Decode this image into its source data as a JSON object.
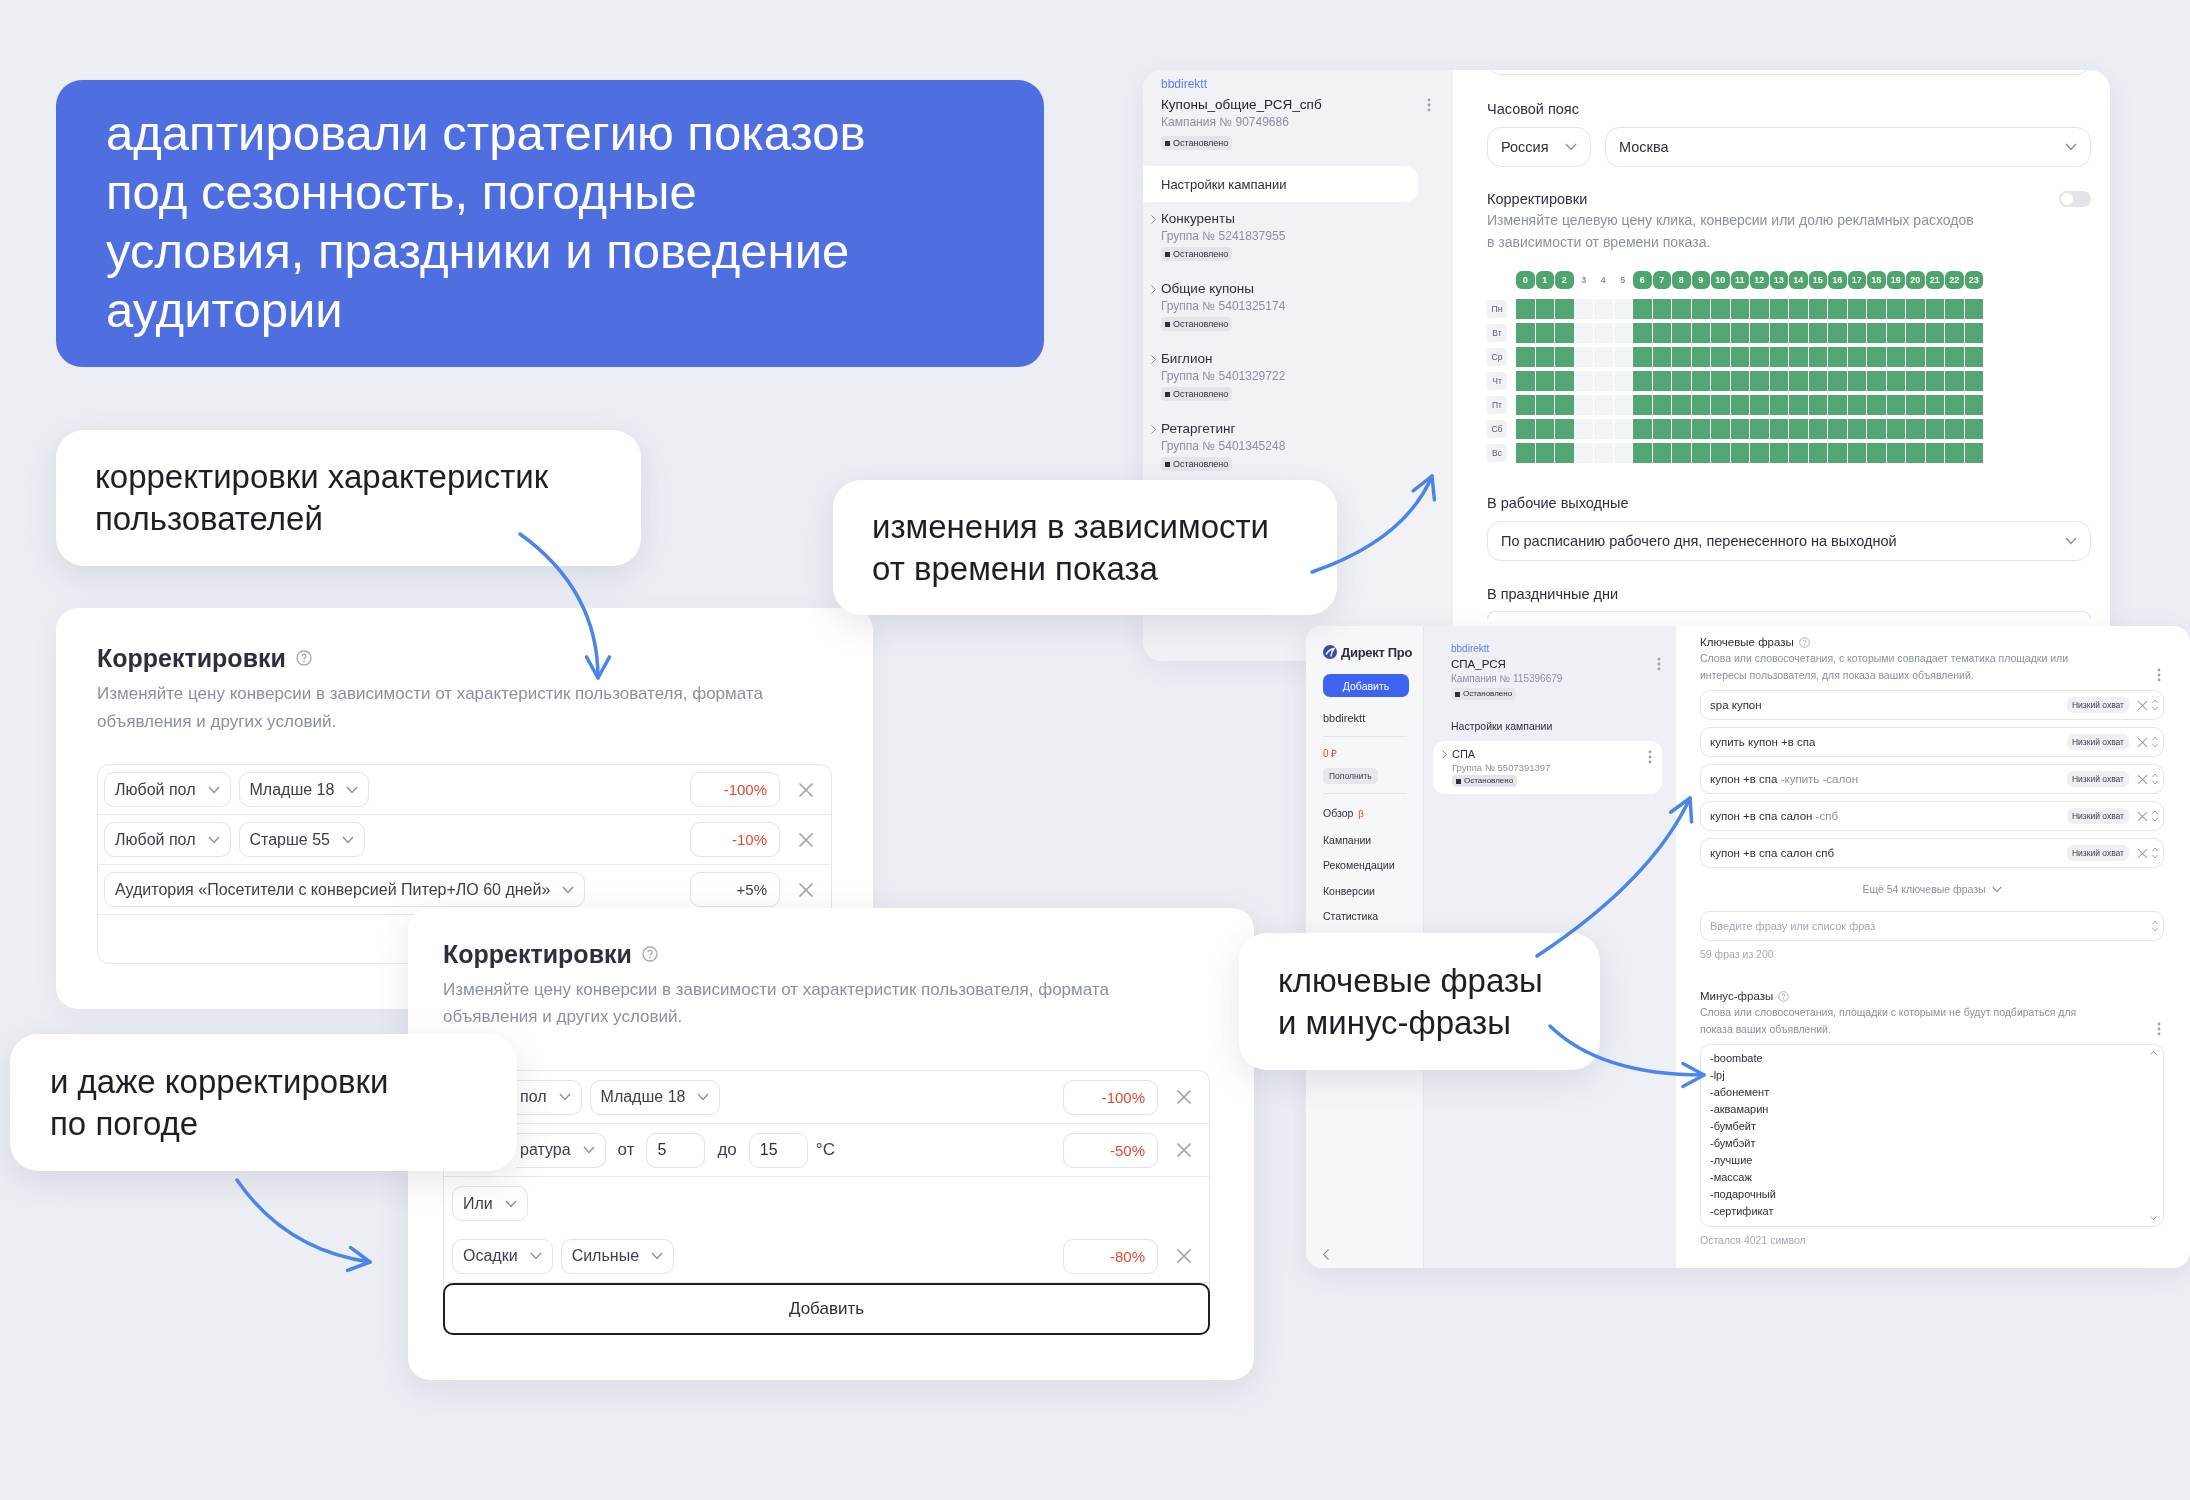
{
  "headline": {
    "lines": [
      "адаптировали стратегию показов",
      "под сезонность, погодные",
      "условия, праздники и поведение",
      "аудитории"
    ]
  },
  "campaign_window": {
    "account": "bbdirektt",
    "campaign": "Купоны_общие_РСЯ_спб",
    "campaign_number": "Кампания № 90749686",
    "status": "Остановлено",
    "sidebar_items": [
      {
        "kind": "settings",
        "label": "Настройки кампании",
        "selected": true
      },
      {
        "kind": "group",
        "name": "Конкуренты",
        "number": "Группа № 5241837955",
        "status": "Остановлено",
        "selected": false
      },
      {
        "kind": "group",
        "name": "Общие купоны",
        "number": "Группа № 5401325174",
        "status": "Остановлено",
        "selected": false
      },
      {
        "kind": "group",
        "name": "Биглион",
        "number": "Группа № 5401329722",
        "status": "Остановлено",
        "selected": false
      },
      {
        "kind": "group",
        "name": "Ретаргетинг",
        "number": "Группа № 5401345248",
        "status": "Остановлено",
        "selected": false
      }
    ],
    "timezone": {
      "label": "Часовой пояс",
      "country": "Россия",
      "city": "Москва"
    },
    "adjustments": {
      "label": "Корректировки",
      "on": false,
      "description_lines": [
        "Изменяйте целевую цену клика, конверсии или долю рекламных расходов",
        "в зависимости от времени показа."
      ]
    },
    "schedule": {
      "hours": [
        {
          "label": "0",
          "on": true
        },
        {
          "label": "1",
          "on": true
        },
        {
          "label": "2",
          "on": true
        },
        {
          "label": "3",
          "on": false
        },
        {
          "label": "4",
          "on": false
        },
        {
          "label": "5",
          "on": false
        },
        {
          "label": "6",
          "on": true
        },
        {
          "label": "7",
          "on": true
        },
        {
          "label": "8",
          "on": true
        },
        {
          "label": "9",
          "on": true
        },
        {
          "label": "10",
          "on": true
        },
        {
          "label": "11",
          "on": true
        },
        {
          "label": "12",
          "on": true
        },
        {
          "label": "13",
          "on": true
        },
        {
          "label": "14",
          "on": true
        },
        {
          "label": "15",
          "on": true
        },
        {
          "label": "16",
          "on": true
        },
        {
          "label": "17",
          "on": true
        },
        {
          "label": "18",
          "on": true
        },
        {
          "label": "19",
          "on": true
        },
        {
          "label": "20",
          "on": true
        },
        {
          "label": "21",
          "on": true
        },
        {
          "label": "22",
          "on": true
        },
        {
          "label": "23",
          "on": true
        }
      ],
      "days": [
        {
          "label": "Пн",
          "cells": [
            true,
            true,
            true,
            false,
            false,
            false,
            true,
            true,
            true,
            true,
            true,
            true,
            true,
            true,
            true,
            true,
            true,
            true,
            true,
            true,
            true,
            true,
            true,
            true
          ]
        },
        {
          "label": "Вт",
          "cells": [
            true,
            true,
            true,
            false,
            false,
            false,
            true,
            true,
            true,
            true,
            true,
            true,
            true,
            true,
            true,
            true,
            true,
            true,
            true,
            true,
            true,
            true,
            true,
            true
          ]
        },
        {
          "label": "Ср",
          "cells": [
            true,
            true,
            true,
            false,
            false,
            false,
            true,
            true,
            true,
            true,
            true,
            true,
            true,
            true,
            true,
            true,
            true,
            true,
            true,
            true,
            true,
            true,
            true,
            true
          ]
        },
        {
          "label": "Чт",
          "cells": [
            true,
            true,
            true,
            false,
            false,
            false,
            true,
            true,
            true,
            true,
            true,
            true,
            true,
            true,
            true,
            true,
            true,
            true,
            true,
            true,
            true,
            true,
            true,
            true
          ]
        },
        {
          "label": "Пт",
          "cells": [
            true,
            true,
            true,
            false,
            false,
            false,
            true,
            true,
            true,
            true,
            true,
            true,
            true,
            true,
            true,
            true,
            true,
            true,
            true,
            true,
            true,
            true,
            true,
            true
          ]
        },
        {
          "label": "Сб",
          "cells": [
            true,
            true,
            true,
            false,
            false,
            false,
            true,
            true,
            true,
            true,
            true,
            true,
            true,
            true,
            true,
            true,
            true,
            true,
            true,
            true,
            true,
            true,
            true,
            true
          ]
        },
        {
          "label": "Вс",
          "cells": [
            true,
            true,
            true,
            false,
            false,
            false,
            true,
            true,
            true,
            true,
            true,
            true,
            true,
            true,
            true,
            true,
            true,
            true,
            true,
            true,
            true,
            true,
            true,
            true
          ]
        }
      ]
    },
    "working_weekends": {
      "label": "В рабочие выходные",
      "value": "По расписанию рабочего дня, перенесенного на выходной"
    },
    "holidays": {
      "label": "В праздничные дни"
    }
  },
  "direct_window": {
    "brand": "Директ Про",
    "add_button": "Добавить",
    "account": "bbdirektt",
    "balance": "0 ₽",
    "topup_button": "Пополнить",
    "nav": [
      {
        "label": "Обзор",
        "badge": "β"
      },
      {
        "label": "Кампании"
      },
      {
        "label": "Рекомендации"
      },
      {
        "label": "Конверсии"
      },
      {
        "label": "Статистика"
      }
    ],
    "campaign": {
      "account": "bbdirektt",
      "name": "СПА_РСЯ",
      "number": "Кампания № 115396679",
      "status": "Остановлено"
    },
    "settings_label": "Настройки кампании",
    "groups": [
      {
        "name": "СПА",
        "number": "Группа № 5507391397",
        "status": "Остановлено",
        "selected": true
      }
    ],
    "keywords": {
      "title": "Ключевые фразы",
      "description_lines": [
        "Слова или словосочетания, с которыми совпадает тематика площадки или",
        "интересы пользователя, для показа ваших объявлений."
      ],
      "phrases": [
        {
          "text": "spa купон",
          "reach": "Низкий охват"
        },
        {
          "text": "купить купон +в спа",
          "reach": "Низкий охват"
        },
        {
          "text": "купон +в спа",
          "minus_words": "-купить -салон",
          "reach": "Низкий охват"
        },
        {
          "text": "купон +в спа салон",
          "minus_words": "-спб",
          "reach": "Низкий охват"
        },
        {
          "text": "купон +в спа салон спб",
          "reach": "Низкий охват"
        }
      ],
      "more": "Ещё 54 ключевые фразы",
      "input_placeholder": "Введите фразу или список фраз",
      "counter": "59 фраз из 200"
    },
    "minus_phrases": {
      "title": "Минус-фразы",
      "description_lines": [
        "Слова или словосочетания, площадки с которыми не будут подбираться для",
        "показа ваших объявлений."
      ],
      "phrases": [
        "-boombate",
        "-lpj",
        "-абонемент",
        "-аквамарин",
        "-бумбейт",
        "-бумбэйт",
        "-лучшие",
        "-массаж",
        "-подарочный",
        "-сертификат"
      ],
      "counter": "Остался 4021 символ"
    }
  },
  "adjustment_cards": [
    {
      "title": "Корректировки",
      "description_lines": [
        "Изменяйте цену конверсии в зависимости от характеристик пользователя, формата",
        "объявления и других условий."
      ],
      "rows": [
        {
          "kind": "condition",
          "selectors": [
            "Любой пол",
            "Младше 18"
          ],
          "value": "-100%",
          "negative": true
        },
        {
          "kind": "condition",
          "selectors": [
            "Любой пол",
            "Старше 55"
          ],
          "value": "-10%",
          "negative": true
        },
        {
          "kind": "condition",
          "selectors": [
            "Аудитория «Посетители с конверсией Питер+ЛО 60 дней»"
          ],
          "value": "+5%",
          "negative": false
        }
      ]
    },
    {
      "title": "Корректировки",
      "description_lines": [
        "Изменяйте цену конверсии в зависимости от характеристик пользователя, формата",
        "объявления и других условий."
      ],
      "rows": [
        {
          "kind": "condition",
          "selectors": [
            "пол",
            "Младше 18"
          ],
          "value": "-100%",
          "negative": true
        },
        {
          "kind": "temperature",
          "selector": "ратура",
          "from_label": "от",
          "from": "5",
          "to_label": "до",
          "to": "15",
          "unit": "°C",
          "value": "-50%",
          "negative": true
        },
        {
          "kind": "operator",
          "selector": "Или"
        },
        {
          "kind": "condition",
          "selectors": [
            "Осадки",
            "Сильные"
          ],
          "value": "-80%",
          "negative": true
        }
      ],
      "add_button": "Добавить"
    }
  ],
  "callouts": [
    {
      "lines": [
        "корректировки характеристик",
        "пользователей"
      ]
    },
    {
      "lines": [
        "изменения в зависимости",
        "от времени показа"
      ]
    },
    {
      "lines": [
        "ключевые фразы",
        "и минус-фразы"
      ]
    },
    {
      "lines": [
        "и даже корректировки",
        "по погоде"
      ]
    }
  ]
}
